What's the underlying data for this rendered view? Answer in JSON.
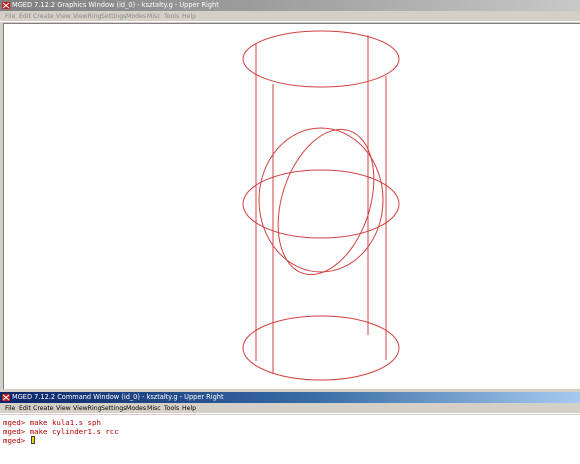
{
  "graphics_window": {
    "title": "MGED 7.12.2 Graphics Window (id_0) - kształty.g - Upper Right",
    "menu": [
      "File",
      "Edit",
      "Create",
      "View",
      "ViewRing",
      "Settings",
      "Modes",
      "Misc",
      "Tools",
      "Help"
    ],
    "wireframe_color": "#d04040"
  },
  "command_window": {
    "title": "MGED 7.12.2 Command Window (id_0) - kształty.g - Upper Right",
    "menu": [
      "File",
      "Edit",
      "Create",
      "View",
      "ViewRing",
      "Settings",
      "Modes",
      "Misc",
      "Tools",
      "Help"
    ],
    "console_lines": [
      {
        "prompt": "mged>",
        "command": "make kula1.s sph"
      },
      {
        "prompt": "mged>",
        "command": "make cylinder1.s rcc"
      },
      {
        "prompt": "mged>",
        "command": ""
      }
    ]
  },
  "colors": {
    "title_active": "#0a246a",
    "title_inactive": "#7f7f7f",
    "console_text": "#b00000",
    "cursor": "#e6d800"
  }
}
